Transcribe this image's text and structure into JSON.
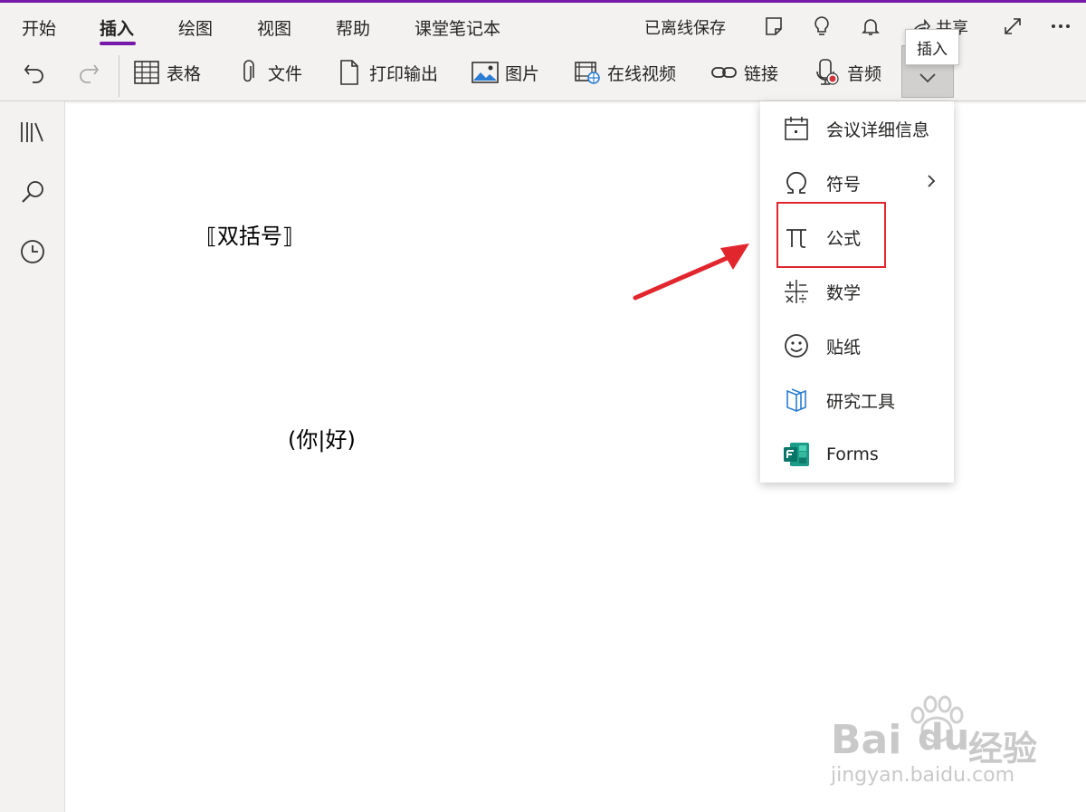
{
  "tabs": [
    "开始",
    "插入",
    "绘图",
    "视图",
    "帮助",
    "课堂笔记本"
  ],
  "active_tab": "插入",
  "header": {
    "status": "已离线保存",
    "share_label": "共享"
  },
  "colors": {
    "accent": "#7719aa",
    "highlight": "#e1262e",
    "ribbon_bg": "#f3f2f1"
  },
  "toolbar": {
    "table": "表格",
    "file": "文件",
    "printout": "打印输出",
    "picture": "图片",
    "online_video": "在线视频",
    "link": "链接",
    "audio": "音频",
    "tooltip": "插入"
  },
  "icons": {
    "rail": [
      "notebooks-icon",
      "search-icon",
      "recent-clock-icon"
    ],
    "toolbar": [
      "undo-icon",
      "redo-icon",
      "table-icon",
      "paperclip-icon",
      "document-icon",
      "picture-icon",
      "online-video-icon",
      "link-icon",
      "audio-icon",
      "chevron-down-icon"
    ]
  },
  "note": {
    "line1": "⟦双括号⟧",
    "line2": "(你|好)"
  },
  "dropdown": {
    "meeting": "会议详细信息",
    "symbol": "符号",
    "equation": "公式",
    "math": "数学",
    "sticker": "贴纸",
    "research": "研究工具",
    "forms": "Forms"
  },
  "watermark": {
    "brand": "Bai",
    "brand2": "du",
    "brand_cn": "经验",
    "url": "jingyan.baidu.com"
  }
}
